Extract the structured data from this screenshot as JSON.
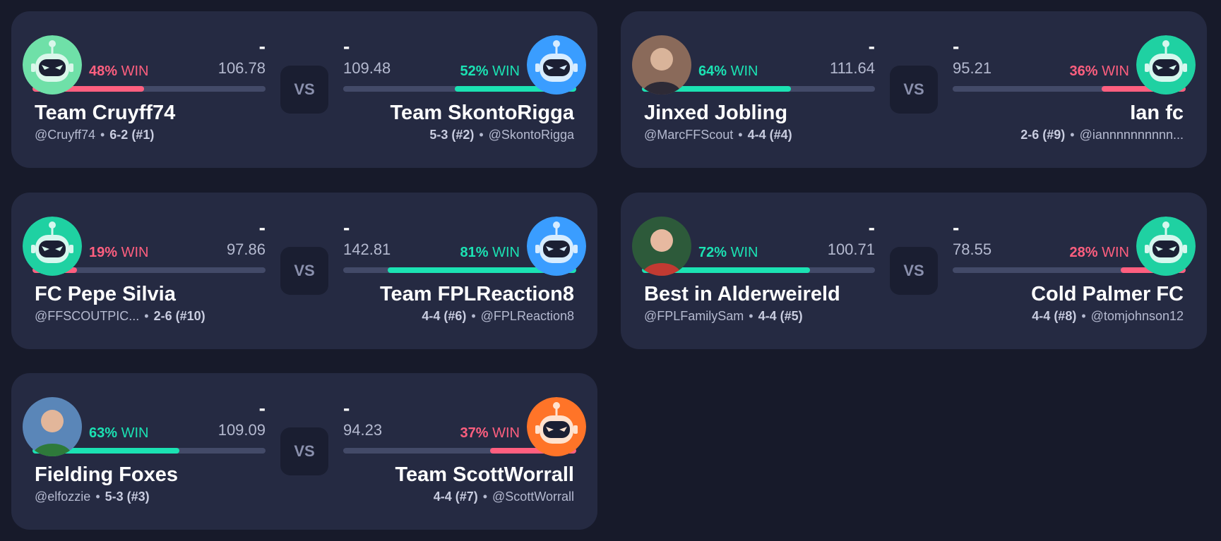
{
  "colors": {
    "loser": "#ff5f7f",
    "winner": "#1be2b3",
    "card_bg": "#252a42",
    "page_bg": "#171a2a"
  },
  "vs_label": "VS",
  "win_label": "WIN",
  "matchups": [
    {
      "left": {
        "dash": "-",
        "points": "106.78",
        "win_pct": "48%",
        "win_value": 0.48,
        "result": "loser",
        "team": "Team Cruyff74",
        "handle": "@Cruyff74",
        "record": "6-2 (#1)",
        "avatar": "robot-green-icon"
      },
      "right": {
        "dash": "-",
        "points": "109.48",
        "win_pct": "52%",
        "win_value": 0.52,
        "result": "winner",
        "team": "Team SkontoRigga",
        "handle": "@SkontoRigga",
        "record": "5-3 (#2)",
        "avatar": "robot-blue-icon"
      }
    },
    {
      "left": {
        "dash": "-",
        "points": "111.64",
        "win_pct": "64%",
        "win_value": 0.64,
        "result": "winner",
        "team": "Jinxed Jobling",
        "handle": "@MarcFFScout",
        "record": "4-4 (#4)",
        "avatar": "user-photo"
      },
      "right": {
        "dash": "-",
        "points": "95.21",
        "win_pct": "36%",
        "win_value": 0.36,
        "result": "loser",
        "team": "Ian fc",
        "handle": "@iannnnnnnnnn...",
        "record": "2-6 (#9)",
        "avatar": "robot-teal-icon"
      }
    },
    {
      "left": {
        "dash": "-",
        "points": "97.86",
        "win_pct": "19%",
        "win_value": 0.19,
        "result": "loser",
        "team": "FC Pepe Silvia",
        "handle": "@FFSCOUTPIC...",
        "record": "2-6 (#10)",
        "avatar": "robot-teal-icon"
      },
      "right": {
        "dash": "-",
        "points": "142.81",
        "win_pct": "81%",
        "win_value": 0.81,
        "result": "winner",
        "team": "Team FPLReaction8",
        "handle": "@FPLReaction8",
        "record": "4-4 (#6)",
        "avatar": "robot-blue-icon"
      }
    },
    {
      "left": {
        "dash": "-",
        "points": "100.71",
        "win_pct": "72%",
        "win_value": 0.72,
        "result": "winner",
        "team": "Best in Alderweireld",
        "handle": "@FPLFamilySam",
        "record": "4-4 (#5)",
        "avatar": "user-photo"
      },
      "right": {
        "dash": "-",
        "points": "78.55",
        "win_pct": "28%",
        "win_value": 0.28,
        "result": "loser",
        "team": "Cold Palmer FC",
        "handle": "@tomjohnson12",
        "record": "4-4 (#8)",
        "avatar": "robot-teal-icon"
      }
    },
    {
      "left": {
        "dash": "-",
        "points": "109.09",
        "win_pct": "63%",
        "win_value": 0.63,
        "result": "winner",
        "team": "Fielding Foxes",
        "handle": "@elfozzie",
        "record": "5-3 (#3)",
        "avatar": "user-photo"
      },
      "right": {
        "dash": "-",
        "points": "94.23",
        "win_pct": "37%",
        "win_value": 0.37,
        "result": "loser",
        "team": "Team ScottWorrall",
        "handle": "@ScottWorrall",
        "record": "4-4 (#7)",
        "avatar": "robot-orange-icon"
      }
    }
  ]
}
